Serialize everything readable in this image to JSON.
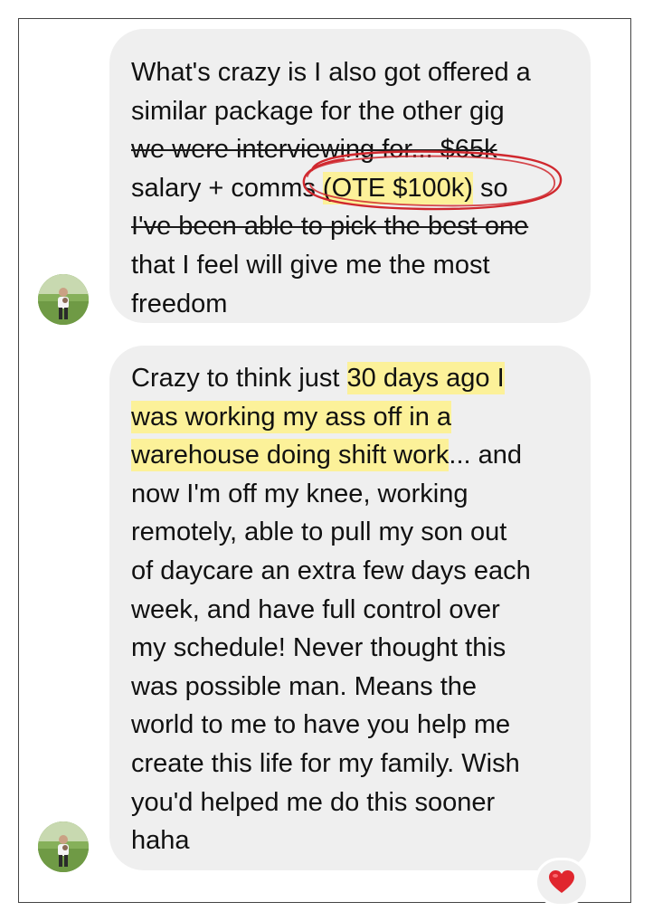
{
  "messages": [
    {
      "lines": [
        "What's crazy is I also got offered a",
        "similar package for the other gig"
      ],
      "line3_struck": "we were interviewing for... $65k",
      "line4_start": "salary + comms ",
      "line4_highlight": "(OTE $100k)",
      "line4_end": " so",
      "line5": "I've been able to pick the best one",
      "lines_end": [
        "that I feel will give me the most",
        "freedom"
      ]
    },
    {
      "line1_start": "Crazy to think just ",
      "line1_highlight": "30 days ago I",
      "line2_highlight": "was working my ass off in a",
      "line3_highlight": "warehouse doing shift work",
      "line3_end": "... and",
      "lines_end": [
        "now I'm off my knee, working",
        "remotely, able to pull my son out",
        "of daycare an extra few days each",
        "week, and have full control over",
        "my schedule! Never thought this",
        "was possible man. Means the",
        "world to me to have you help me",
        "create this life for my family. Wish",
        "you'd helped me do this sooner",
        "haha"
      ]
    }
  ],
  "reaction": {
    "emoji": "❤️",
    "icon": "heart-icon"
  },
  "colors": {
    "bubble": "#efefef",
    "highlight": "#fff180",
    "annotation_circle": "#d0282e"
  }
}
